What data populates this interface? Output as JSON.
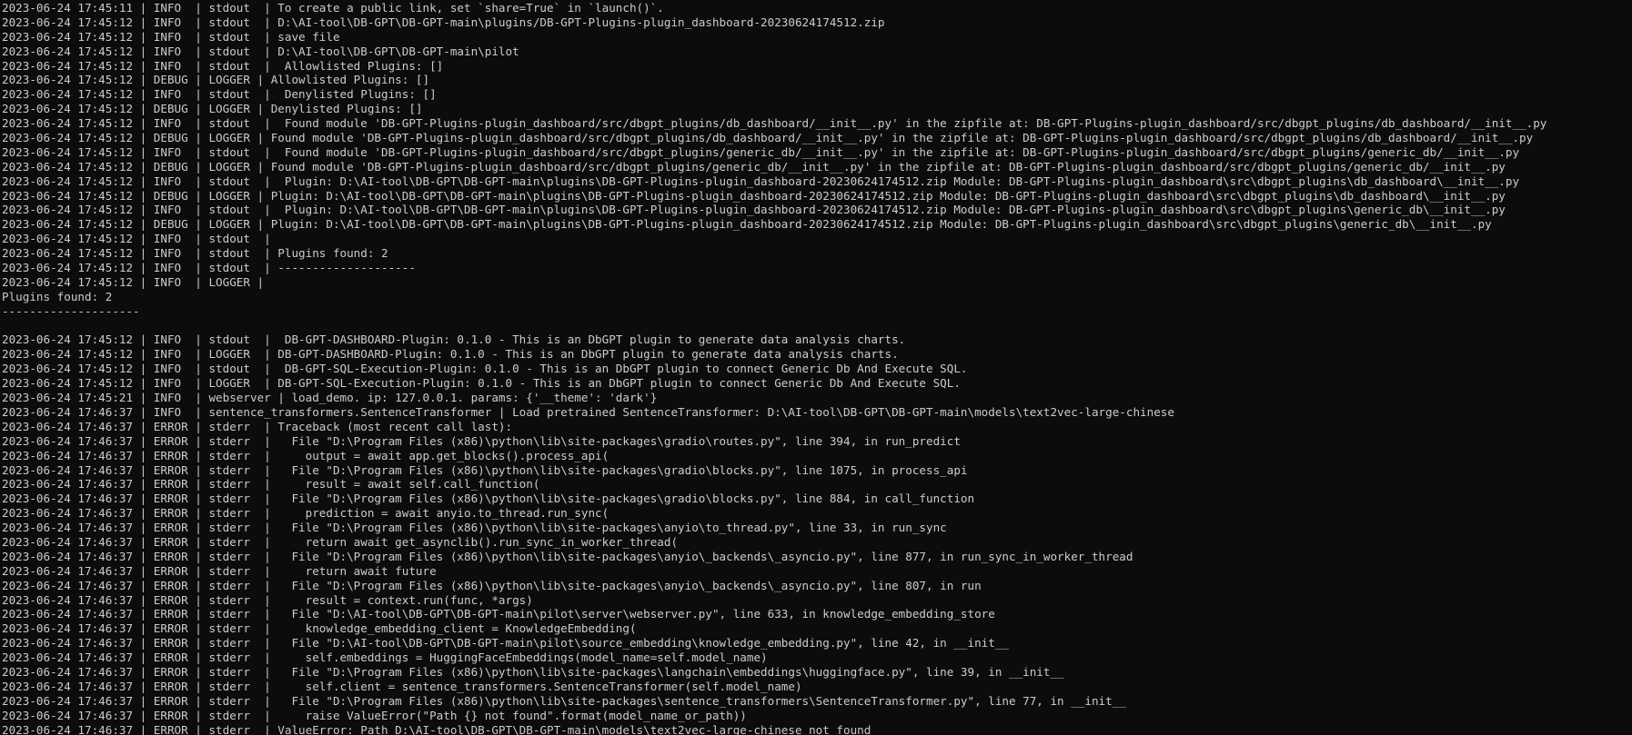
{
  "terminal": {
    "lines": [
      "2023-06-24 17:45:11 | INFO  | stdout  | To create a public link, set `share=True` in `launch()`.",
      "2023-06-24 17:45:12 | INFO  | stdout  | D:\\AI-tool\\DB-GPT\\DB-GPT-main\\plugins/DB-GPT-Plugins-plugin_dashboard-20230624174512.zip",
      "2023-06-24 17:45:12 | INFO  | stdout  | save file",
      "2023-06-24 17:45:12 | INFO  | stdout  | D:\\AI-tool\\DB-GPT\\DB-GPT-main\\pilot",
      "2023-06-24 17:45:12 | INFO  | stdout  |  Allowlisted Plugins: []",
      "2023-06-24 17:45:12 | DEBUG | LOGGER | Allowlisted Plugins: []",
      "2023-06-24 17:45:12 | INFO  | stdout  |  Denylisted Plugins: []",
      "2023-06-24 17:45:12 | DEBUG | LOGGER | Denylisted Plugins: []",
      "2023-06-24 17:45:12 | INFO  | stdout  |  Found module 'DB-GPT-Plugins-plugin_dashboard/src/dbgpt_plugins/db_dashboard/__init__.py' in the zipfile at: DB-GPT-Plugins-plugin_dashboard/src/dbgpt_plugins/db_dashboard/__init__.py",
      "2023-06-24 17:45:12 | DEBUG | LOGGER | Found module 'DB-GPT-Plugins-plugin_dashboard/src/dbgpt_plugins/db_dashboard/__init__.py' in the zipfile at: DB-GPT-Plugins-plugin_dashboard/src/dbgpt_plugins/db_dashboard/__init__.py",
      "2023-06-24 17:45:12 | INFO  | stdout  |  Found module 'DB-GPT-Plugins-plugin_dashboard/src/dbgpt_plugins/generic_db/__init__.py' in the zipfile at: DB-GPT-Plugins-plugin_dashboard/src/dbgpt_plugins/generic_db/__init__.py",
      "2023-06-24 17:45:12 | DEBUG | LOGGER | Found module 'DB-GPT-Plugins-plugin_dashboard/src/dbgpt_plugins/generic_db/__init__.py' in the zipfile at: DB-GPT-Plugins-plugin_dashboard/src/dbgpt_plugins/generic_db/__init__.py",
      "2023-06-24 17:45:12 | INFO  | stdout  |  Plugin: D:\\AI-tool\\DB-GPT\\DB-GPT-main\\plugins\\DB-GPT-Plugins-plugin_dashboard-20230624174512.zip Module: DB-GPT-Plugins-plugin_dashboard\\src\\dbgpt_plugins\\db_dashboard\\__init__.py",
      "2023-06-24 17:45:12 | DEBUG | LOGGER | Plugin: D:\\AI-tool\\DB-GPT\\DB-GPT-main\\plugins\\DB-GPT-Plugins-plugin_dashboard-20230624174512.zip Module: DB-GPT-Plugins-plugin_dashboard\\src\\dbgpt_plugins\\db_dashboard\\__init__.py",
      "2023-06-24 17:45:12 | INFO  | stdout  |  Plugin: D:\\AI-tool\\DB-GPT\\DB-GPT-main\\plugins\\DB-GPT-Plugins-plugin_dashboard-20230624174512.zip Module: DB-GPT-Plugins-plugin_dashboard\\src\\dbgpt_plugins\\generic_db\\__init__.py",
      "2023-06-24 17:45:12 | DEBUG | LOGGER | Plugin: D:\\AI-tool\\DB-GPT\\DB-GPT-main\\plugins\\DB-GPT-Plugins-plugin_dashboard-20230624174512.zip Module: DB-GPT-Plugins-plugin_dashboard\\src\\dbgpt_plugins\\generic_db\\__init__.py",
      "2023-06-24 17:45:12 | INFO  | stdout  |",
      "2023-06-24 17:45:12 | INFO  | stdout  | Plugins found: 2",
      "2023-06-24 17:45:12 | INFO  | stdout  | --------------------",
      "2023-06-24 17:45:12 | INFO  | LOGGER |",
      "Plugins found: 2",
      "--------------------",
      "",
      "2023-06-24 17:45:12 | INFO  | stdout  |  DB-GPT-DASHBOARD-Plugin: 0.1.0 - This is an DbGPT plugin to generate data analysis charts.",
      "2023-06-24 17:45:12 | INFO  | LOGGER  | DB-GPT-DASHBOARD-Plugin: 0.1.0 - This is an DbGPT plugin to generate data analysis charts.",
      "2023-06-24 17:45:12 | INFO  | stdout  |  DB-GPT-SQL-Execution-Plugin: 0.1.0 - This is an DbGPT plugin to connect Generic Db And Execute SQL.",
      "2023-06-24 17:45:12 | INFO  | LOGGER  | DB-GPT-SQL-Execution-Plugin: 0.1.0 - This is an DbGPT plugin to connect Generic Db And Execute SQL.",
      "2023-06-24 17:45:21 | INFO  | webserver | load_demo. ip: 127.0.0.1. params: {'__theme': 'dark'}",
      "2023-06-24 17:46:37 | INFO  | sentence_transformers.SentenceTransformer | Load pretrained SentenceTransformer: D:\\AI-tool\\DB-GPT\\DB-GPT-main\\models\\text2vec-large-chinese",
      "2023-06-24 17:46:37 | ERROR | stderr  | Traceback (most recent call last):",
      "2023-06-24 17:46:37 | ERROR | stderr  |   File \"D:\\Program Files (x86)\\python\\lib\\site-packages\\gradio\\routes.py\", line 394, in run_predict",
      "2023-06-24 17:46:37 | ERROR | stderr  |     output = await app.get_blocks().process_api(",
      "2023-06-24 17:46:37 | ERROR | stderr  |   File \"D:\\Program Files (x86)\\python\\lib\\site-packages\\gradio\\blocks.py\", line 1075, in process_api",
      "2023-06-24 17:46:37 | ERROR | stderr  |     result = await self.call_function(",
      "2023-06-24 17:46:37 | ERROR | stderr  |   File \"D:\\Program Files (x86)\\python\\lib\\site-packages\\gradio\\blocks.py\", line 884, in call_function",
      "2023-06-24 17:46:37 | ERROR | stderr  |     prediction = await anyio.to_thread.run_sync(",
      "2023-06-24 17:46:37 | ERROR | stderr  |   File \"D:\\Program Files (x86)\\python\\lib\\site-packages\\anyio\\to_thread.py\", line 33, in run_sync",
      "2023-06-24 17:46:37 | ERROR | stderr  |     return await get_asynclib().run_sync_in_worker_thread(",
      "2023-06-24 17:46:37 | ERROR | stderr  |   File \"D:\\Program Files (x86)\\python\\lib\\site-packages\\anyio\\_backends\\_asyncio.py\", line 877, in run_sync_in_worker_thread",
      "2023-06-24 17:46:37 | ERROR | stderr  |     return await future",
      "2023-06-24 17:46:37 | ERROR | stderr  |   File \"D:\\Program Files (x86)\\python\\lib\\site-packages\\anyio\\_backends\\_asyncio.py\", line 807, in run",
      "2023-06-24 17:46:37 | ERROR | stderr  |     result = context.run(func, *args)",
      "2023-06-24 17:46:37 | ERROR | stderr  |   File \"D:\\AI-tool\\DB-GPT\\DB-GPT-main\\pilot\\server\\webserver.py\", line 633, in knowledge_embedding_store",
      "2023-06-24 17:46:37 | ERROR | stderr  |     knowledge_embedding_client = KnowledgeEmbedding(",
      "2023-06-24 17:46:37 | ERROR | stderr  |   File \"D:\\AI-tool\\DB-GPT\\DB-GPT-main\\pilot\\source_embedding\\knowledge_embedding.py\", line 42, in __init__",
      "2023-06-24 17:46:37 | ERROR | stderr  |     self.embeddings = HuggingFaceEmbeddings(model_name=self.model_name)",
      "2023-06-24 17:46:37 | ERROR | stderr  |   File \"D:\\Program Files (x86)\\python\\lib\\site-packages\\langchain\\embeddings\\huggingface.py\", line 39, in __init__",
      "2023-06-24 17:46:37 | ERROR | stderr  |     self.client = sentence_transformers.SentenceTransformer(self.model_name)",
      "2023-06-24 17:46:37 | ERROR | stderr  |   File \"D:\\Program Files (x86)\\python\\lib\\site-packages\\sentence_transformers\\SentenceTransformer.py\", line 77, in __init__",
      "2023-06-24 17:46:37 | ERROR | stderr  |     raise ValueError(\"Path {} not found\".format(model_name_or_path))",
      "2023-06-24 17:46:37 | ERROR | stderr  | ValueError: Path D:\\AI-tool\\DB-GPT\\DB-GPT-main\\models\\text2vec-large-chinese not found"
    ]
  }
}
